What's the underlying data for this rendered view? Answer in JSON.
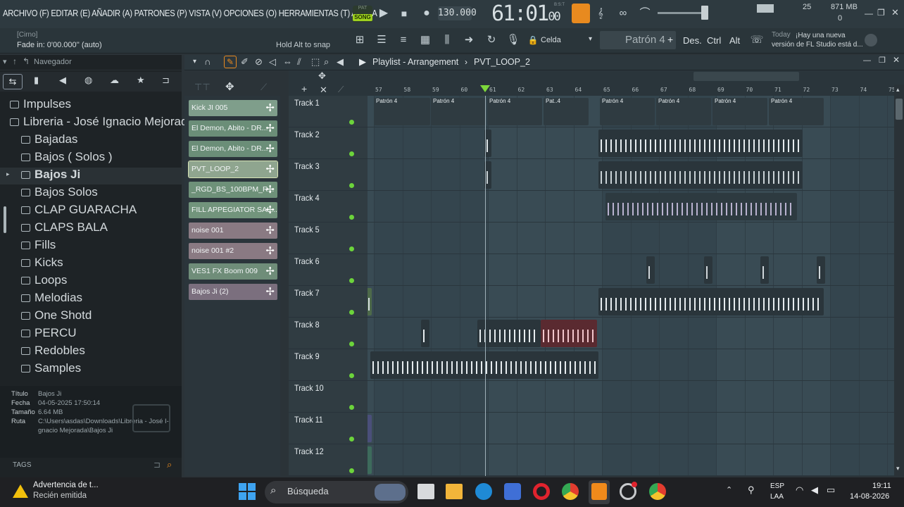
{
  "menubar": {
    "menu": "ARCHIVO (F) EDITAR (E) AÑADIR (A) PATRONES (P) VISTA (V) OPCIONES (O) HERRAMIENTAS (T) AYUDA",
    "song_label": "SONG",
    "pat_label": "PAT",
    "tempo": "130.000",
    "time_main": "61:01",
    "time_sub": "00",
    "time_unit": "B:S:T",
    "cpu_value": "25",
    "memory": "871 MB",
    "voices": "0"
  },
  "hint": {
    "line1": "[Cirno]",
    "line2": "Fade in: 0'00.000'' (auto)",
    "snap": "Hold Alt to snap"
  },
  "toolbar2": {
    "snap_mode": "Celda",
    "pattern": "Patrón 4",
    "btn_des": "Des.",
    "btn_ctrl": "Ctrl",
    "btn_alt": "Alt",
    "news_when": "Today",
    "news_text": "¡Hay una nueva versión de FL Studio está d..."
  },
  "browser": {
    "title": "Navegador",
    "items": [
      {
        "label": "Impulses",
        "open": false
      },
      {
        "label": "Libreria - José Ignacio Mejorada",
        "open": true
      },
      {
        "label": "Bajadas"
      },
      {
        "label": "Bajos ( Solos )"
      },
      {
        "label": "Bajos Ji",
        "selected": true
      },
      {
        "label": "Bajos Solos"
      },
      {
        "label": "CLAP GUARACHA"
      },
      {
        "label": "CLAPS BALA"
      },
      {
        "label": "Fills"
      },
      {
        "label": "Kicks"
      },
      {
        "label": "Loops"
      },
      {
        "label": "Melodias"
      },
      {
        "label": "One Shotd"
      },
      {
        "label": "PERCU"
      },
      {
        "label": "Redobles"
      },
      {
        "label": "Samples"
      }
    ],
    "info": {
      "titulo_k": "Título",
      "titulo_v": "Bajos Ji",
      "fecha_k": "Fecha",
      "fecha_v": "04-05-2025 17:50:14",
      "tam_k": "Tamaño",
      "tam_v": "6.64 MB",
      "ruta_k": "Ruta",
      "ruta_v1": "C:\\Users\\asdas\\Downloads\\Libreria - José I-",
      "ruta_v2": "gnacio Mejorada\\Bajos Ji"
    },
    "tags": "TAGS"
  },
  "playlist": {
    "title": "Playlist - Arrangement",
    "breadcrumb_sep": "›",
    "clip_name": "PVT_LOOP_2",
    "ruler": [
      "57",
      "58",
      "59",
      "60",
      "61",
      "62",
      "63",
      "64",
      "65",
      "66",
      "67",
      "68",
      "69",
      "70",
      "71",
      "72",
      "73",
      "74",
      "75"
    ],
    "picker": [
      {
        "label": "Kick JI 005",
        "color": "#7f9e8b"
      },
      {
        "label": "El Demon, Abito - DR...",
        "color": "#6b8e78"
      },
      {
        "label": "El Demon, Abito - DR...",
        "color": "#6b8e78"
      },
      {
        "label": "PVT_LOOP_2",
        "color": "#8fa58f",
        "selected": true
      },
      {
        "label": "_RGD_BS_100BPM_R...",
        "color": "#6e9179"
      },
      {
        "label": "FILL APPEGIATOR SAL...",
        "color": "#72947c"
      },
      {
        "label": "noise 001",
        "color": "#8a7a83"
      },
      {
        "label": "noise 001 #2",
        "color": "#8a7a83"
      },
      {
        "label": "VES1 FX Boom 009",
        "color": "#6f8d79"
      },
      {
        "label": "Bajos Ji  (2)",
        "color": "#7b6f7e"
      }
    ],
    "tracks": [
      "Track 1",
      "Track 2",
      "Track 3",
      "Track 4",
      "Track 5",
      "Track 6",
      "Track 7",
      "Track 8",
      "Track 9",
      "Track 10",
      "Track 11",
      "Track 12"
    ],
    "track1_clips": [
      "Patrón 4",
      "Patrón 4",
      "Patrón 4",
      "Pat..4",
      "Patrón 4",
      "Patrón 4",
      "Patrón 4",
      "Patrón 4"
    ]
  },
  "taskbar": {
    "notif_title": "Advertencia de t...",
    "notif_sub": "Recién emitida",
    "search": "Búsqueda",
    "lang1": "ESP",
    "lang2": "LAA",
    "time": "19:11",
    "date": "14-08-2026"
  }
}
